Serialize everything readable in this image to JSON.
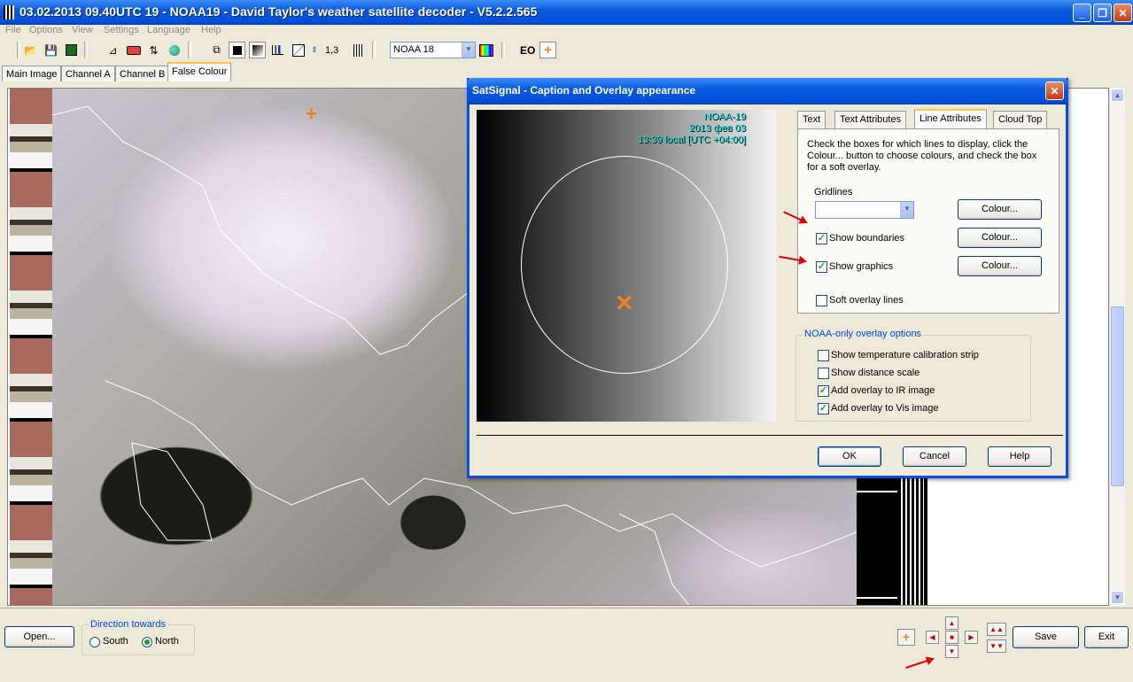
{
  "window": {
    "title": "03.02.2013 09.40UTC 19 - NOAA19 - David Taylor's weather satellite decoder - V5.2.2.565",
    "min": "_",
    "max": "❐",
    "close": "✕"
  },
  "menu": [
    "File",
    "Options",
    "View",
    "Settings",
    "Language",
    "Help"
  ],
  "toolbar": {
    "zoom_label": "1,3",
    "satellite": "NOAA 18",
    "eo_label": "EO"
  },
  "tabs": [
    "Main Image",
    "Channel A",
    "Channel B",
    "False Colour"
  ],
  "dialog": {
    "title": "SatSignal - Caption and  Overlay appearance",
    "preview_caption": [
      "NOAA-19",
      "2013 фев 03",
      "13:39  local [UTC +04:00]"
    ],
    "tabs": [
      "Text",
      "Text Attributes",
      "Line Attributes",
      "Cloud Top"
    ],
    "instructions": "Check the boxes for which lines to display, click the Colour... button to choose colours, and check the box for a soft overlay.",
    "gridlines_label": "Gridlines",
    "gridlines_value": "",
    "colour_button": "Colour...",
    "show_boundaries": {
      "label": "Show boundaries",
      "checked": true
    },
    "show_graphics": {
      "label": "Show graphics",
      "checked": true
    },
    "soft_overlay": {
      "label": "Soft overlay lines",
      "checked": false
    },
    "noaa_group": {
      "label": "NOAA-only overlay options",
      "options": [
        {
          "label": "Show temperature calibration strip",
          "checked": false
        },
        {
          "label": "Show distance scale",
          "checked": false
        },
        {
          "label": "Add overlay to IR image",
          "checked": true
        },
        {
          "label": "Add overlay to Vis image",
          "checked": true
        }
      ]
    },
    "ok": "OK",
    "cancel": "Cancel",
    "help": "Help"
  },
  "bottom": {
    "open": "Open...",
    "direction_label": "Direction towards",
    "south": "South",
    "north": "North",
    "direction_selected": "North",
    "save": "Save",
    "exit": "Exit"
  },
  "colors": {
    "accent": "#0a5ae0",
    "highlight_tab": "#ffc83c",
    "annotation_arrow": "#e00000",
    "caption_text": "#00e6e6",
    "marker": "#f08020"
  }
}
